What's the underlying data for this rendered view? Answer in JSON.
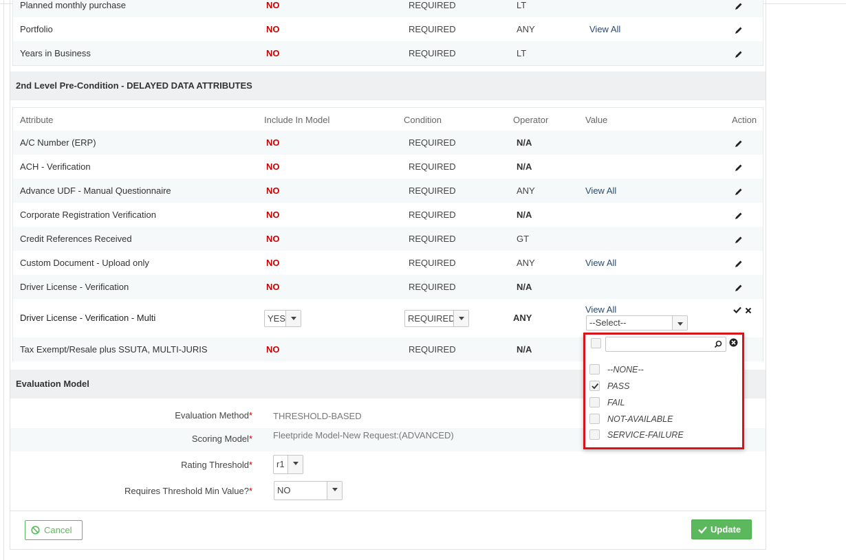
{
  "top_table": {
    "rows": [
      {
        "attribute": "Planned monthly purchase",
        "include": "NO",
        "condition": "REQUIRED",
        "operator": "LT",
        "value": ""
      },
      {
        "attribute": "Portfolio",
        "include": "NO",
        "condition": "REQUIRED",
        "operator": "ANY",
        "value": "View All"
      },
      {
        "attribute": "Years in Business",
        "include": "NO",
        "condition": "REQUIRED",
        "operator": "LT",
        "value": ""
      }
    ]
  },
  "section2": {
    "title": "2nd Level Pre-Condition - DELAYED DATA ATTRIBUTES",
    "headers": {
      "attribute": "Attribute",
      "include": "Include In Model",
      "condition": "Condition",
      "operator": "Operator",
      "value": "Value",
      "action": "Action"
    },
    "rows": [
      {
        "attribute": "A/C Number (ERP)",
        "include": "NO",
        "condition": "REQUIRED",
        "operator": "N/A",
        "value": ""
      },
      {
        "attribute": "ACH - Verification",
        "include": "NO",
        "condition": "REQUIRED",
        "operator": "N/A",
        "value": ""
      },
      {
        "attribute": "Advance UDF - Manual Questionnaire",
        "include": "NO",
        "condition": "REQUIRED",
        "operator": "ANY",
        "value": "View All"
      },
      {
        "attribute": "Corporate Registration Verification",
        "include": "NO",
        "condition": "REQUIRED",
        "operator": "N/A",
        "value": ""
      },
      {
        "attribute": "Credit References Received",
        "include": "NO",
        "condition": "REQUIRED",
        "operator": "GT",
        "value": ""
      },
      {
        "attribute": "Custom Document - Upload only",
        "include": "NO",
        "condition": "REQUIRED",
        "operator": "ANY",
        "value": "View All"
      },
      {
        "attribute": "Driver License - Verification",
        "include": "NO",
        "condition": "REQUIRED",
        "operator": "N/A",
        "value": ""
      }
    ],
    "editing_row": {
      "attribute": "Driver License - Verification - Multi",
      "include_select": "YES",
      "condition_select": "REQUIRED",
      "operator": "ANY",
      "value_link": "View All",
      "value_select": "--Select--"
    },
    "last_row": {
      "attribute": "Tax Exempt/Resale plus SSUTA, MULTI-JURIS",
      "include": "NO",
      "condition": "REQUIRED",
      "operator": "N/A"
    }
  },
  "dropdown": {
    "search_placeholder": "",
    "options": [
      {
        "label": "--NONE--",
        "checked": false
      },
      {
        "label": "PASS",
        "checked": true
      },
      {
        "label": "FAIL",
        "checked": false
      },
      {
        "label": "NOT-AVAILABLE",
        "checked": false
      },
      {
        "label": "SERVICE-FAILURE",
        "checked": false
      }
    ],
    "highlight_color": "#d7141a"
  },
  "evaluation": {
    "title": "Evaluation Model",
    "method_label": "Evaluation Method",
    "method_value": "THRESHOLD-BASED",
    "scoring_label": "Scoring Model",
    "scoring_value": "Fleetpride Model-New Request:(ADVANCED)",
    "rating_label": "Rating Threshold",
    "rating_value": "r1",
    "min_label": "Requires Threshold Min Value?",
    "min_value": "NO",
    "required_mark": "*"
  },
  "footer": {
    "cancel_label": "Cancel",
    "update_label": "Update",
    "accent_color": "#5cb85c"
  }
}
